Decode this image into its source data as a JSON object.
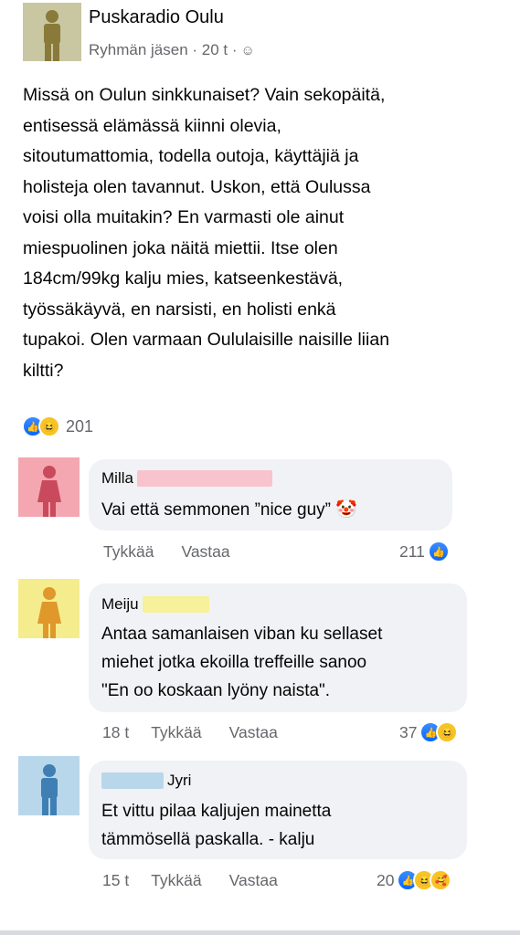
{
  "post": {
    "group_name": "Puskaradio Oulu",
    "meta_text": "Ryhmän jäsen · 20 t ·",
    "privacy_icon": "group-icon",
    "avatar_color": "#c9c6a2",
    "text": "Missä on Oulun sinkkunaiset? Vain sekopäitä,\nentisessä elämässä kiinni olevia,\nsitoutumattomia, todella outoja, käyttäjiä ja\nholisteja olen tavannut. Uskon, että Oulussa\nvoisi olla muitakin? En varmasti ole ainut\nmiespuolinen joka näitä miettii. Itse olen\n184cm/99kg kalju mies, katseenkestävä,\ntyössäkäyvä, en narsisti, en holisti enkä\ntupakoi. Olen varmaan Oululaisille naisille liian\nkiltti?",
    "reaction_count": "201",
    "reactions": [
      "like",
      "haha"
    ]
  },
  "comments": [
    {
      "author": "Milla",
      "avatar_color": "#f4a7b0",
      "redaction_color": "#f8c3cc",
      "text": "Vai että semmonen ”nice guy” 🤡",
      "time": "",
      "like_label": "Tykkää",
      "reply_label": "Vastaa",
      "reaction_count": "211",
      "reactions": [
        "like"
      ]
    },
    {
      "author": "Meiju",
      "avatar_color": "#f5ec8d",
      "redaction_color": "#f6f19a",
      "text": "Antaa samanlaisen viban ku sellaset\nmiehet jotka ekoilla treffeille sanoo\n\"En oo koskaan lyöny naista\".",
      "time": "18 t",
      "like_label": "Tykkää",
      "reply_label": "Vastaa",
      "reaction_count": "37",
      "reactions": [
        "like",
        "haha"
      ]
    },
    {
      "author": "Jyri",
      "avatar_color": "#b9d7ea",
      "redaction_color": "#b9d7ea",
      "text": "Et vittu pilaa kaljujen mainetta\ntämmösellä paskalla. - kalju",
      "time": "15 t",
      "like_label": "Tykkää",
      "reply_label": "Vastaa",
      "reaction_count": "20",
      "reactions": [
        "like",
        "haha",
        "care"
      ]
    }
  ]
}
